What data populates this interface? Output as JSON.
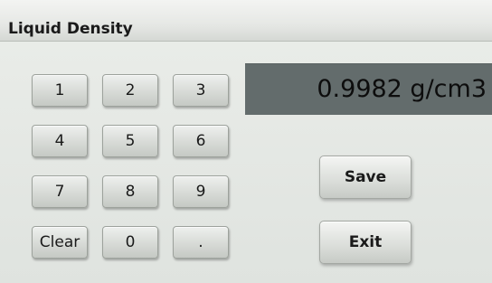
{
  "window": {
    "title": "Liquid Density"
  },
  "display": {
    "value": "0.9982 g/cm3"
  },
  "keypad": {
    "keys": [
      "1",
      "2",
      "3",
      "4",
      "5",
      "6",
      "7",
      "8",
      "9",
      "Clear",
      "0",
      "."
    ]
  },
  "actions": {
    "save_label": "Save",
    "exit_label": "Exit"
  }
}
